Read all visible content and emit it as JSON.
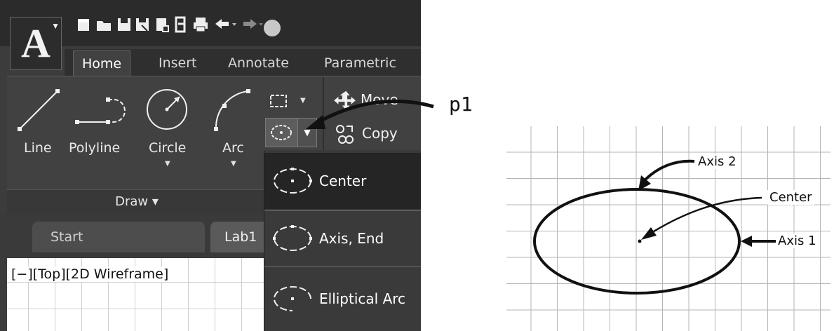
{
  "toolbar": {
    "app_icon": "A",
    "quick_access": [
      "new-icon",
      "open-icon",
      "save-icon",
      "save-as-icon",
      "publish-icon",
      "share-icon",
      "print-icon",
      "undo-icon",
      "redo-icon"
    ]
  },
  "ribbon_tabs": [
    {
      "label": "Home",
      "active": true
    },
    {
      "label": "Insert",
      "active": false
    },
    {
      "label": "Annotate",
      "active": false
    },
    {
      "label": "Parametric",
      "active": false
    }
  ],
  "draw_panel": {
    "tools": [
      {
        "label": "Line",
        "icon": "line-icon",
        "has_menu": false
      },
      {
        "label": "Polyline",
        "icon": "polyline-icon",
        "has_menu": false
      },
      {
        "label": "Circle",
        "icon": "circle-icon",
        "has_menu": true
      },
      {
        "label": "Arc",
        "icon": "arc-icon",
        "has_menu": true
      }
    ],
    "title": "Draw ▾"
  },
  "modify_panel": {
    "move_label": "Move",
    "copy_label": "Copy"
  },
  "ellipse_menu": {
    "items": [
      {
        "label": "Center",
        "icon": "ellipse-center-icon",
        "highlighted": true
      },
      {
        "label": "Axis, End",
        "icon": "ellipse-axis-end-icon",
        "highlighted": false
      },
      {
        "label": "Elliptical Arc",
        "icon": "elliptical-arc-icon",
        "highlighted": false
      }
    ]
  },
  "file_tabs": [
    {
      "label": "Start"
    },
    {
      "label": "Lab1"
    }
  ],
  "viewport": {
    "label": "[−][Top][2D Wireframe]"
  },
  "callout": {
    "label": "p1"
  },
  "diagram": {
    "labels": {
      "axis2": "Axis 2",
      "center": "Center",
      "axis1": "Axis 1"
    }
  }
}
